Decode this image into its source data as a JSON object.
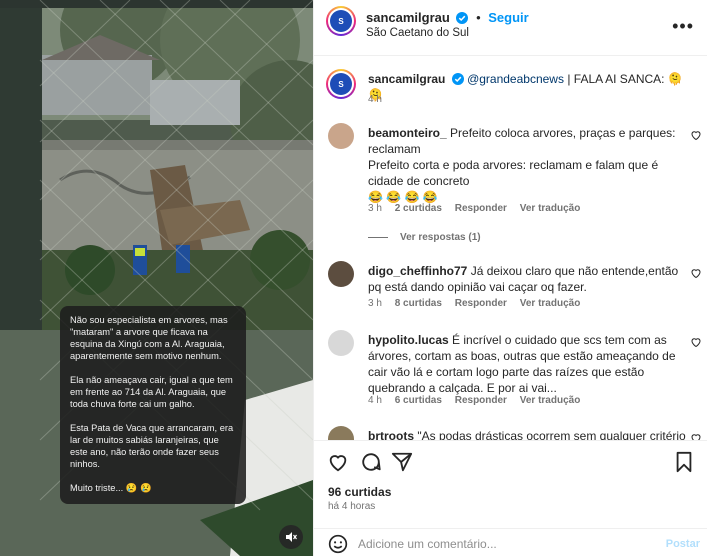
{
  "post": {
    "author": "sancamilgrau",
    "follow_label": "Seguir",
    "location": "São Caetano do Sul",
    "more_icon": "more-horizontal-icon",
    "verified_icon": "verified-badge-icon"
  },
  "caption": {
    "user": "sancamilgrau",
    "mention": "@grandeabcnews",
    "text": "| FALA AI SANCA: 🫠 🫠",
    "time": "4 h"
  },
  "story_overlay": {
    "paragraphs": [
      "Não sou especialista em arvores, mas \"mataram\" a arvore que ficava na esquina da Xingú com a Al. Araguaia, aparentemente sem motivo nenhum.",
      "Ela não ameaçava cair, igual a que tem em frente ao 714 da Al. Araguaia, que toda chuva forte cai um galho.",
      "Esta Pata de Vaca que arrancaram, era lar de muitos sabiás laranjeiras, que este ano, não terão onde fazer seus ninhos.",
      "Muito triste... 😢 😢"
    ],
    "mute_icon": "speaker-muted-icon"
  },
  "comments": [
    {
      "user": "beamonteiro_",
      "text": "Prefeito coloca arvores, praças e parques: reclamam\nPrefeito corta e poda arvores: reclamam e falam que é cidade de concreto\n😂 😂 😂 😂",
      "time": "3 h",
      "likes": "2 curtidas",
      "reply": "Responder",
      "translate": "Ver tradução",
      "view_replies": "Ver respostas (1)"
    },
    {
      "user": "digo_cheffinho77",
      "text": "Já deixou claro que não entende,então pq está dando opinião vai caçar oq fazer.",
      "time": "3 h",
      "likes": "8 curtidas",
      "reply": "Responder",
      "translate": "Ver tradução"
    },
    {
      "user": "hypolito.lucas",
      "text": "É incrível o cuidado que scs tem com as árvores, cortam as boas, outras que estão ameaçando de cair vão lá e cortam logo parte das raízes que estão quebrando a calçada. E por ai vai...",
      "time": "4 h",
      "likes": "6 curtidas",
      "reply": "Responder",
      "translate": "Ver tradução"
    },
    {
      "user": "brtroots",
      "text": "\"As podas drásticas ocorrem sem qualquer critério"
    }
  ],
  "actions": {
    "like_icon": "heart-icon",
    "comment_icon": "comment-icon",
    "share_icon": "share-icon",
    "save_icon": "bookmark-icon"
  },
  "stats": {
    "likes": "96 curtidas",
    "time": "há 4 horas"
  },
  "composer": {
    "emoji_icon": "emoji-icon",
    "placeholder": "Adicione um comentário...",
    "post_label": "Postar"
  },
  "colors": {
    "accent": "#0095f6",
    "post_disabled": "#b2dffc",
    "muted_text": "#737373"
  }
}
